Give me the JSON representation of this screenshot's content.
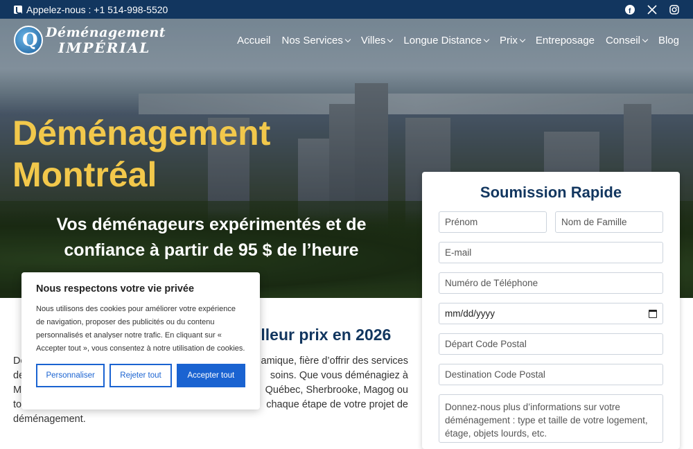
{
  "topbar": {
    "phone_text": "Appelez-nous : +1 514-998-5520",
    "socials": [
      "facebook-icon",
      "x-icon",
      "instagram-icon"
    ]
  },
  "logo": {
    "line1": "Déménagement",
    "line2": "IMPÉRIAL"
  },
  "nav": {
    "items": [
      {
        "label": "Accueil",
        "dropdown": false
      },
      {
        "label": "Nos Services",
        "dropdown": true
      },
      {
        "label": "Villes",
        "dropdown": true
      },
      {
        "label": "Longue Distance",
        "dropdown": true
      },
      {
        "label": "Prix",
        "dropdown": true
      },
      {
        "label": "Entreposage",
        "dropdown": false
      },
      {
        "label": "Conseil",
        "dropdown": true
      },
      {
        "label": "Blog",
        "dropdown": false
      }
    ]
  },
  "hero": {
    "title_line1": "Déménagement",
    "title_line2": "Montréal",
    "subtitle": "Vos déménageurs expérimentés et de confiance à partir de 95 $ de l’heure"
  },
  "section": {
    "title_visible": "illeur prix en 2026",
    "line1_left": "De",
    "line1_right": "amique, fière d’offrir des services",
    "line2_left": "de",
    "line2_right": "soins. Que vous déménagiez à",
    "line3_left": "M",
    "line3_right": "Québec, Sherbrooke, Magog ou",
    "line4_left": "to",
    "line4_right": "chaque étape de votre projet de",
    "line5": "déménagement."
  },
  "form": {
    "title": "Soumission Rapide",
    "first_name_placeholder": "Prénom",
    "last_name_placeholder": "Nom de Famille",
    "email_placeholder": "E-mail",
    "phone_placeholder": "Numéro de Téléphone",
    "date_placeholder": "mm/dd/yyyy",
    "from_postal_placeholder": "Départ Code Postal",
    "to_postal_placeholder": "Destination Code Postal",
    "details_placeholder": "Donnez-nous plus d’informations sur votre déménagement : type et taille de votre logement, étage, objets lourds, etc."
  },
  "cookie": {
    "title": "Nous respectons votre vie privée",
    "text": "Nous utilisons des cookies pour améliorer votre expérience de navigation, proposer des publicités ou du contenu personnalisés et analyser notre trafic. En cliquant sur « Accepter tout », vous consentez à notre utilisation de cookies.",
    "customize_label": "Personnaliser",
    "reject_label": "Rejeter tout",
    "accept_label": "Accepter tout"
  },
  "colors": {
    "brand_navy": "#12365f",
    "accent_yellow": "#f2c84b",
    "cookie_blue": "#1a63d1"
  }
}
